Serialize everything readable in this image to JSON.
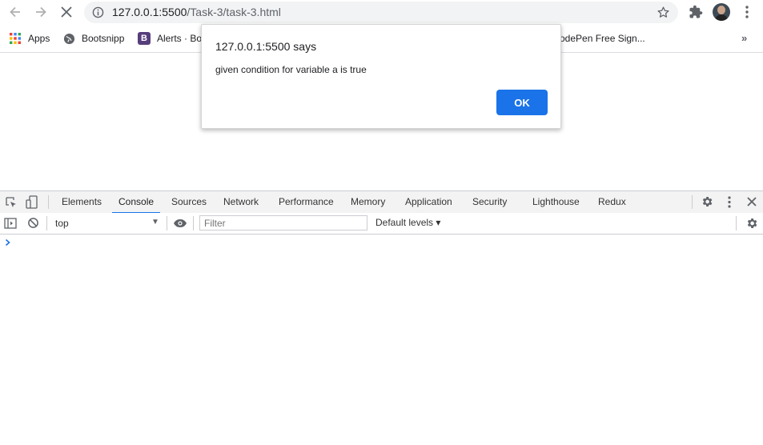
{
  "browser": {
    "url_host": "127.0.0.1:5500",
    "url_path": "/Task-3/task-3.html"
  },
  "bookmarks": [
    {
      "label": "Apps",
      "icon": "apps-grid-icon"
    },
    {
      "label": "Bootsnipp",
      "icon": "globe-icon"
    },
    {
      "label": "Alerts · Boo",
      "icon": "bootstrap-icon"
    },
    {
      "label": "odePen Free Sign...",
      "icon": "codepen-icon"
    }
  ],
  "dialog": {
    "title": "127.0.0.1:5500 says",
    "message": "given condition for variable a is true",
    "ok_label": "OK"
  },
  "devtools": {
    "tabs": [
      "Elements",
      "Console",
      "Sources",
      "Network",
      "Performance",
      "Memory",
      "Application",
      "Security",
      "Lighthouse",
      "Redux"
    ],
    "active_tab": "Console",
    "context": "top",
    "filter_placeholder": "Filter",
    "levels_label": "Default levels ▾"
  },
  "colors": {
    "accent": "#1a73e8"
  }
}
